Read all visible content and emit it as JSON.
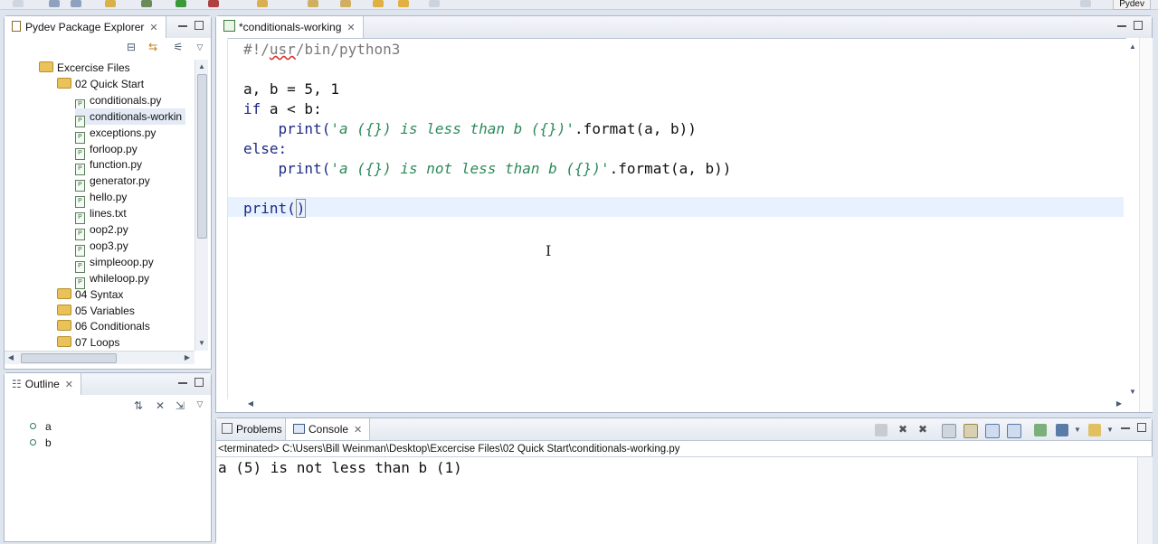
{
  "toolbar": {
    "perspective_label": "Pydev"
  },
  "explorer": {
    "tab_label": "Pydev Package Explorer",
    "tree": [
      {
        "label": "Excercise Files",
        "kind": "folder",
        "depth": 0
      },
      {
        "label": "02 Quick Start",
        "kind": "folder",
        "depth": 1
      },
      {
        "label": "conditionals.py",
        "kind": "file",
        "depth": 2
      },
      {
        "label": "conditionals-workin",
        "kind": "file",
        "depth": 2,
        "selected": true
      },
      {
        "label": "exceptions.py",
        "kind": "file",
        "depth": 2
      },
      {
        "label": "forloop.py",
        "kind": "file",
        "depth": 2
      },
      {
        "label": "function.py",
        "kind": "file",
        "depth": 2
      },
      {
        "label": "generator.py",
        "kind": "file",
        "depth": 2
      },
      {
        "label": "hello.py",
        "kind": "file",
        "depth": 2
      },
      {
        "label": "lines.txt",
        "kind": "file",
        "depth": 2
      },
      {
        "label": "oop2.py",
        "kind": "file",
        "depth": 2
      },
      {
        "label": "oop3.py",
        "kind": "file",
        "depth": 2
      },
      {
        "label": "simpleoop.py",
        "kind": "file",
        "depth": 2
      },
      {
        "label": "whileloop.py",
        "kind": "file",
        "depth": 2
      },
      {
        "label": "04 Syntax",
        "kind": "folder",
        "depth": 1
      },
      {
        "label": "05 Variables",
        "kind": "folder",
        "depth": 1
      },
      {
        "label": "06 Conditionals",
        "kind": "folder",
        "depth": 1
      },
      {
        "label": "07 Loops",
        "kind": "folder",
        "depth": 1
      }
    ]
  },
  "outline": {
    "tab_label": "Outline",
    "items": [
      "a",
      "b"
    ]
  },
  "editor": {
    "tab_label": "*conditionals-working",
    "lines": {
      "l1_prefix": "#!/",
      "l1_usr": "usr",
      "l1_rest": "/bin/python3",
      "l3": "a, b = 5, 1",
      "l4_kw": "if",
      "l4_rest": " a < b:",
      "l5_fn": "    print(",
      "l5_str": "'a ({}) is less than b ({})'",
      "l5_rest": ".format(a, b))",
      "l6": "else:",
      "l7_fn": "    print(",
      "l7_str": "'a ({}) is not less than b ({})'",
      "l7_rest": ".format(a, b))",
      "l9_a": "print(",
      "l9_b": ")"
    }
  },
  "console": {
    "tab_problems": "Problems",
    "tab_console": "Console",
    "status": "<terminated> C:\\Users\\Bill Weinman\\Desktop\\Excercise Files\\02 Quick Start\\conditionals-working.py",
    "output": "a (5) is not less than b (1)"
  }
}
